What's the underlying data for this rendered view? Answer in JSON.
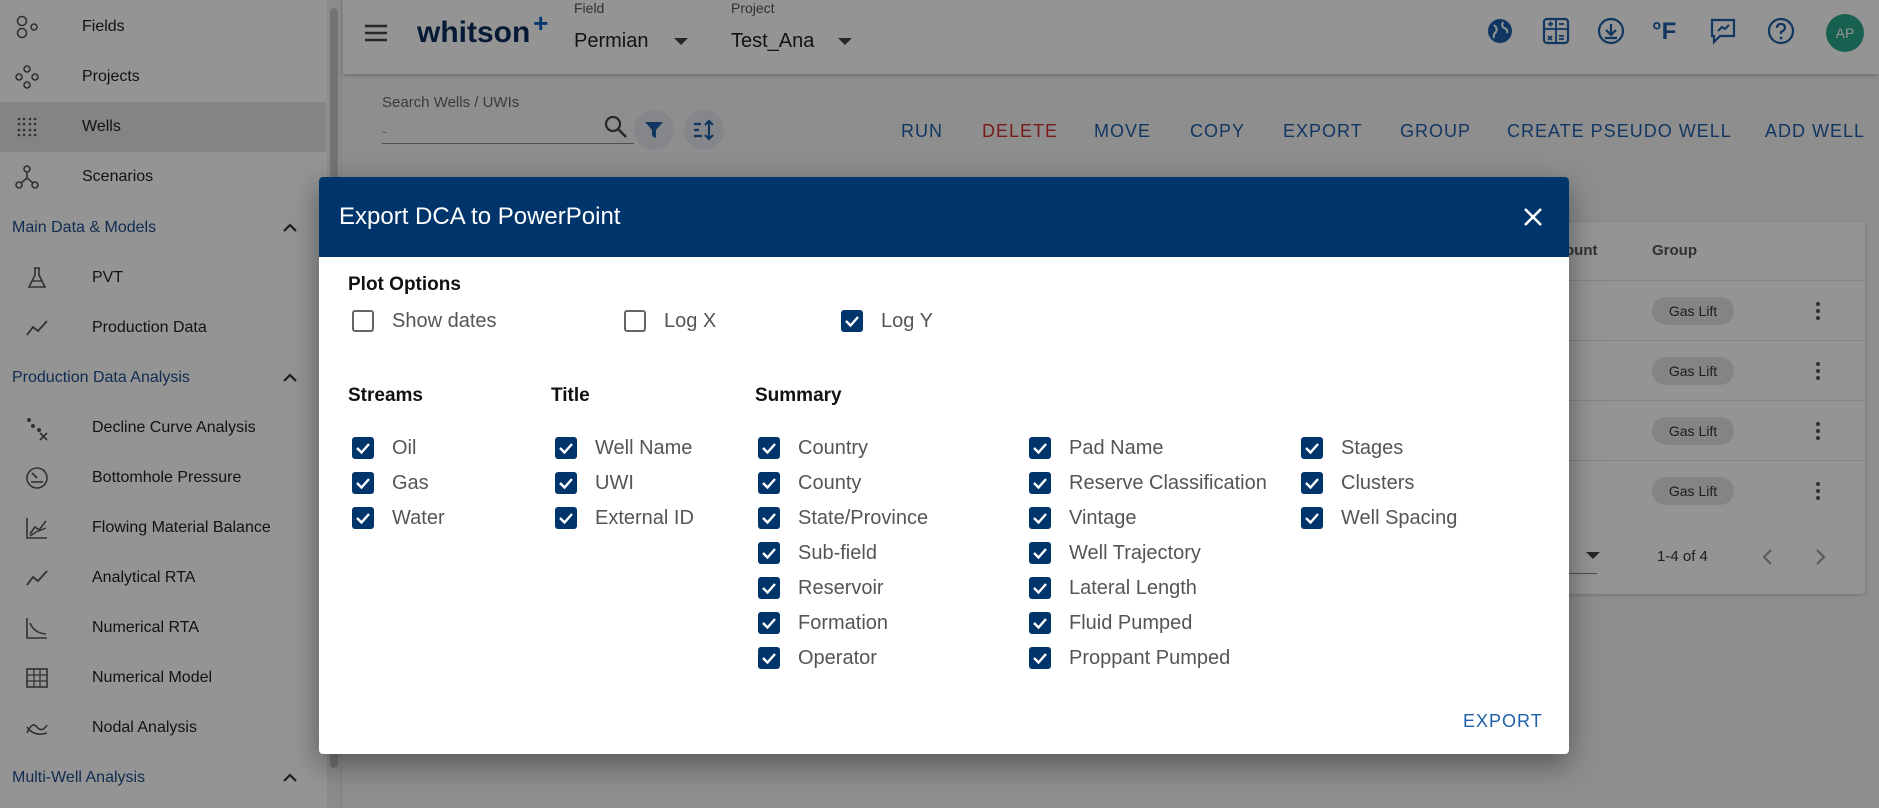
{
  "sidebar": {
    "top_items": [
      {
        "label": "Fields",
        "icon": "fields-icon"
      },
      {
        "label": "Projects",
        "icon": "projects-icon"
      },
      {
        "label": "Wells",
        "icon": "wells-icon"
      },
      {
        "label": "Scenarios",
        "icon": "scenarios-icon"
      }
    ],
    "sections": [
      {
        "title": "Main Data & Models",
        "items": [
          {
            "label": "PVT",
            "icon": "flask-icon"
          },
          {
            "label": "Production Data",
            "icon": "trend-line-icon"
          }
        ]
      },
      {
        "title": "Production Data Analysis",
        "items": [
          {
            "label": "Decline Curve Analysis",
            "icon": "decline-curve-icon"
          },
          {
            "label": "Bottomhole Pressure",
            "icon": "gauge-icon"
          },
          {
            "label": "Flowing Material Balance",
            "icon": "chart-lines-icon"
          },
          {
            "label": "Analytical RTA",
            "icon": "trend-line-icon"
          },
          {
            "label": "Numerical RTA",
            "icon": "decline-chart-icon"
          },
          {
            "label": "Numerical Model",
            "icon": "grid-building-icon"
          },
          {
            "label": "Nodal Analysis",
            "icon": "nodal-icon"
          }
        ]
      },
      {
        "title": "Multi-Well Analysis",
        "items": []
      }
    ]
  },
  "topbar": {
    "logo": "whitson",
    "logo_plus": "+",
    "field_caption": "Field",
    "field_value": "Permian",
    "project_caption": "Project",
    "project_value": "Test_Ana",
    "avatar_initials": "AP"
  },
  "search": {
    "caption": "Search Wells / UWIs",
    "value": "-"
  },
  "actions": [
    "RUN",
    "DELETE",
    "MOVE",
    "COPY",
    "EXPORT",
    "GROUP",
    "CREATE PSEUDO WELL",
    "ADD WELL"
  ],
  "table": {
    "headers": [
      "ount",
      "Group"
    ],
    "rows": [
      {
        "group": "Gas Lift"
      },
      {
        "group": "Gas Lift"
      },
      {
        "group": "Gas Lift"
      },
      {
        "group": "Gas Lift"
      }
    ],
    "pager": "1-4 of 4"
  },
  "dialog": {
    "title": "Export DCA to PowerPoint",
    "plot_options_title": "Plot Options",
    "plot_options": [
      {
        "label": "Show dates",
        "checked": false
      },
      {
        "label": "Log X",
        "checked": false
      },
      {
        "label": "Log Y",
        "checked": true
      }
    ],
    "streams_title": "Streams",
    "streams": [
      {
        "label": "Oil",
        "checked": true
      },
      {
        "label": "Gas",
        "checked": true
      },
      {
        "label": "Water",
        "checked": true
      }
    ],
    "title_section_title": "Title",
    "title_options": [
      {
        "label": "Well Name",
        "checked": true
      },
      {
        "label": "UWI",
        "checked": true
      },
      {
        "label": "External ID",
        "checked": true
      }
    ],
    "summary_title": "Summary",
    "summary_col1": [
      {
        "label": "Country",
        "checked": true
      },
      {
        "label": "County",
        "checked": true
      },
      {
        "label": "State/Province",
        "checked": true
      },
      {
        "label": "Sub-field",
        "checked": true
      },
      {
        "label": "Reservoir",
        "checked": true
      },
      {
        "label": "Formation",
        "checked": true
      },
      {
        "label": "Operator",
        "checked": true
      }
    ],
    "summary_col2": [
      {
        "label": "Pad Name",
        "checked": true
      },
      {
        "label": "Reserve Classification",
        "checked": true
      },
      {
        "label": "Vintage",
        "checked": true
      },
      {
        "label": "Well Trajectory",
        "checked": true
      },
      {
        "label": "Lateral Length",
        "checked": true
      },
      {
        "label": "Fluid Pumped",
        "checked": true
      },
      {
        "label": "Proppant Pumped",
        "checked": true
      }
    ],
    "summary_col3": [
      {
        "label": "Stages",
        "checked": true
      },
      {
        "label": "Clusters",
        "checked": true
      },
      {
        "label": "Well Spacing",
        "checked": true
      }
    ],
    "export_label": "EXPORT"
  },
  "colors": {
    "dialog_header": "#00356b",
    "accent": "#1e5fa8",
    "danger": "#d0302e",
    "avatar": "#2aa58a"
  }
}
